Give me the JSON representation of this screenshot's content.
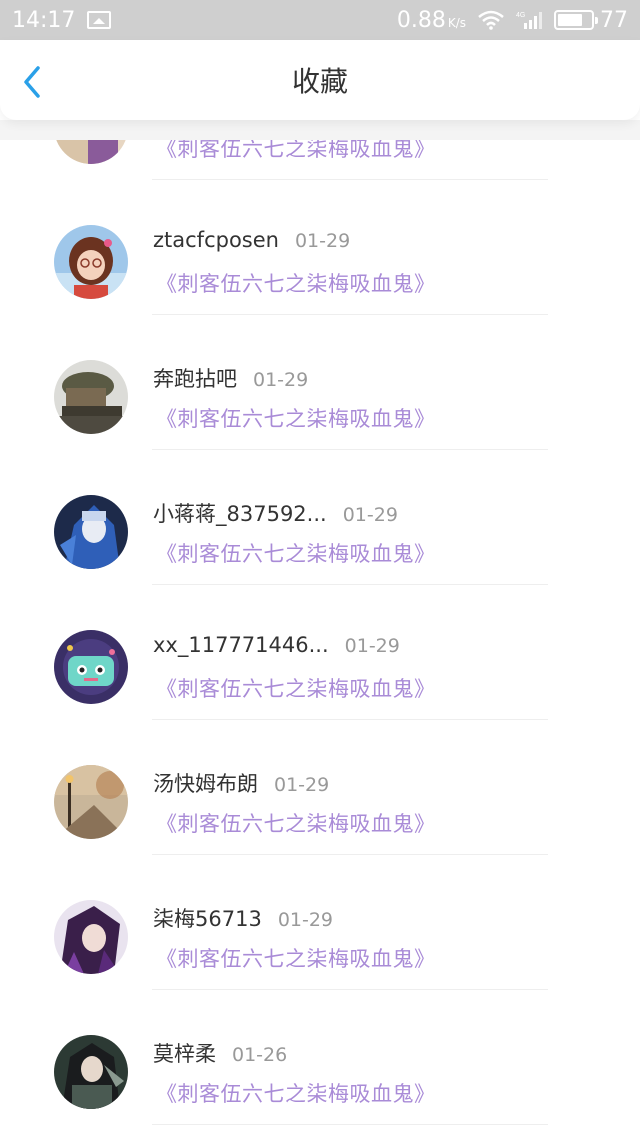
{
  "status_bar": {
    "time": "14:17",
    "speed": "0.88",
    "speed_unit": "K/s",
    "network": "4G",
    "battery": "77",
    "battery_level": 0.77
  },
  "header": {
    "title": "收藏",
    "back_icon": "chevron-left-icon"
  },
  "colors": {
    "accent": "#2aa0e8",
    "book_title": "#a98bd7",
    "name": "#333333",
    "date": "#999999"
  },
  "favorites": [
    {
      "name": "",
      "date": "",
      "book": "《刺客伍六七之柒梅吸血鬼》",
      "avatar": "cartoon-couple-avatar"
    },
    {
      "name": "ztacfcposen",
      "date": "01-29",
      "book": "《刺客伍六七之柒梅吸血鬼》",
      "avatar": "mei-avatar"
    },
    {
      "name": "奔跑拈吧",
      "date": "01-29",
      "book": "《刺客伍六七之柒梅吸血鬼》",
      "avatar": "soldier-avatar"
    },
    {
      "name": "小蒋蒋_837592...",
      "date": "01-29",
      "book": "《刺客伍六七之柒梅吸血鬼》",
      "avatar": "anime-blue-avatar"
    },
    {
      "name": "xx_117771446...",
      "date": "01-29",
      "book": "《刺客伍六七之柒梅吸血鬼》",
      "avatar": "robot-avatar"
    },
    {
      "name": "汤快姆布朗",
      "date": "01-29",
      "book": "《刺客伍六七之柒梅吸血鬼》",
      "avatar": "autumn-street-avatar"
    },
    {
      "name": "柒梅56713",
      "date": "01-29",
      "book": "《刺客伍六七之柒梅吸血鬼》",
      "avatar": "purple-anime-avatar"
    },
    {
      "name": "莫梓柔",
      "date": "01-26",
      "book": "《刺客伍六七之柒梅吸血鬼》",
      "avatar": "dark-anime-avatar"
    }
  ]
}
